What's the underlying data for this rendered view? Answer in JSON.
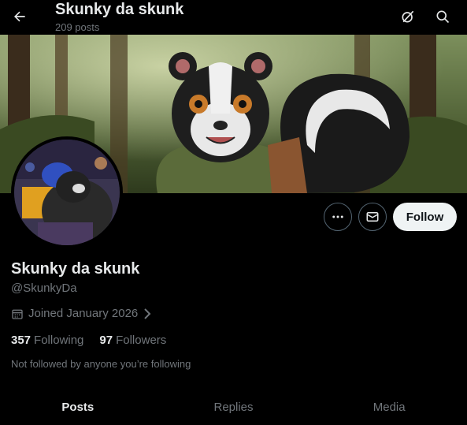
{
  "header": {
    "name": "Skunky da skunk",
    "posts": "209 posts",
    "back_icon": "arrow-left-icon",
    "grok_icon": "grok-icon",
    "search_icon": "search-icon"
  },
  "profile": {
    "name": "Skunky da skunk",
    "handle": "@SkunkyDa",
    "joined": "Joined January 2026",
    "following_count": "357",
    "following_label": "Following",
    "followers_count": "97",
    "followers_label": "Followers",
    "not_followed": "Not followed by anyone you’re following"
  },
  "actions": {
    "follow_label": "Follow",
    "more_icon": "more-icon",
    "message_icon": "envelope-icon"
  },
  "tabs": [
    {
      "label": "Posts",
      "active": true
    },
    {
      "label": "Replies",
      "active": false
    },
    {
      "label": "Media",
      "active": false
    }
  ],
  "colors": {
    "background": "#000000",
    "text_primary": "#e7e9ea",
    "text_secondary": "#71767b",
    "follow_bg": "#eff3f4"
  }
}
